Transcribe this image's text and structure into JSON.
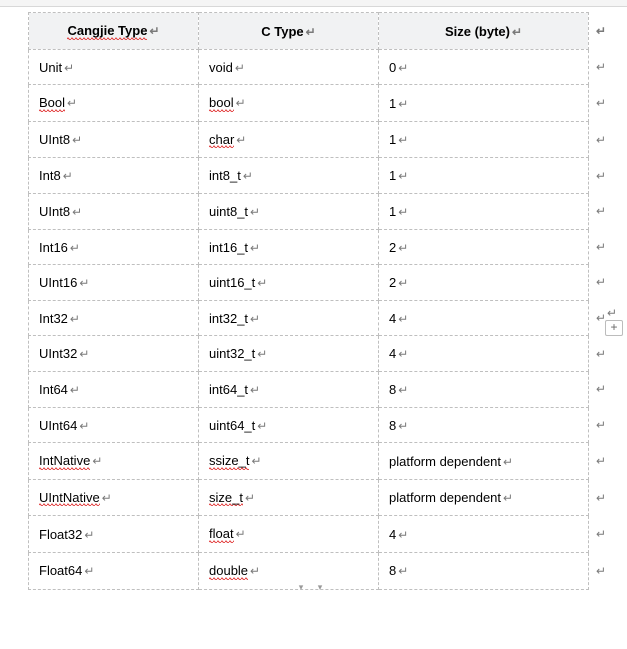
{
  "table": {
    "headers": [
      "Cangjie Type",
      "C Type",
      "Size (byte)"
    ],
    "rows": [
      {
        "cangjie": "Unit",
        "cangjie_sq": false,
        "ctype": "void",
        "ctype_sq": false,
        "size": "0"
      },
      {
        "cangjie": "Bool",
        "cangjie_sq": true,
        "ctype": "bool",
        "ctype_sq": true,
        "size": "1"
      },
      {
        "cangjie": "UInt8",
        "cangjie_sq": false,
        "ctype": "char",
        "ctype_sq": true,
        "size": "1"
      },
      {
        "cangjie": "Int8",
        "cangjie_sq": false,
        "ctype": "int8_t",
        "ctype_sq": false,
        "size": "1"
      },
      {
        "cangjie": "UInt8",
        "cangjie_sq": false,
        "ctype": "uint8_t",
        "ctype_sq": false,
        "size": "1"
      },
      {
        "cangjie": "Int16",
        "cangjie_sq": false,
        "ctype": "int16_t",
        "ctype_sq": false,
        "size": "2"
      },
      {
        "cangjie": "UInt16",
        "cangjie_sq": false,
        "ctype": "uint16_t",
        "ctype_sq": false,
        "size": "2"
      },
      {
        "cangjie": "Int32",
        "cangjie_sq": false,
        "ctype": "int32_t",
        "ctype_sq": false,
        "size": "4"
      },
      {
        "cangjie": "UInt32",
        "cangjie_sq": false,
        "ctype": "uint32_t",
        "ctype_sq": false,
        "size": "4"
      },
      {
        "cangjie": "Int64",
        "cangjie_sq": false,
        "ctype": "int64_t",
        "ctype_sq": false,
        "size": "8"
      },
      {
        "cangjie": "UInt64",
        "cangjie_sq": false,
        "ctype": "uint64_t",
        "ctype_sq": false,
        "size": "8"
      },
      {
        "cangjie": "IntNative",
        "cangjie_sq": true,
        "ctype": "ssize_t",
        "ctype_sq": true,
        "size": "platform dependent"
      },
      {
        "cangjie": "UIntNative",
        "cangjie_sq": true,
        "ctype": "size_t",
        "ctype_sq": true,
        "size": "platform dependent"
      },
      {
        "cangjie": "Float32",
        "cangjie_sq": false,
        "ctype": "float",
        "ctype_sq": true,
        "size": "4"
      },
      {
        "cangjie": "Float64",
        "cangjie_sq": false,
        "ctype": "double",
        "ctype_sq": true,
        "size": "8"
      }
    ]
  },
  "add_button_label": "+"
}
